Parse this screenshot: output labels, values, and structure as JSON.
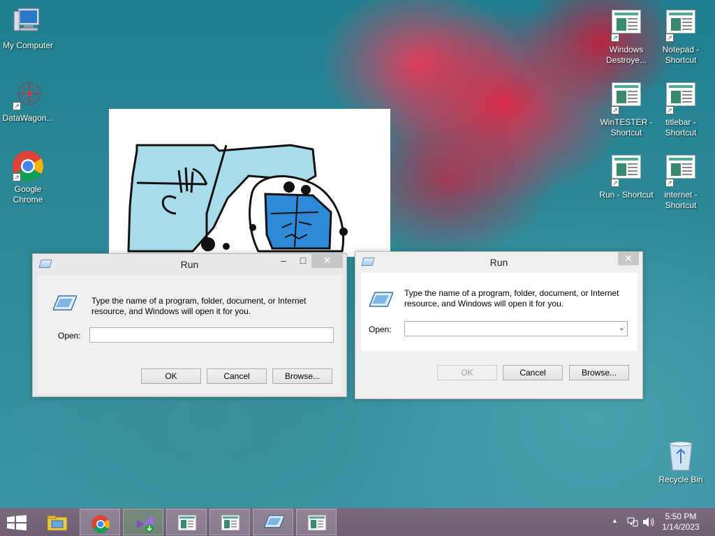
{
  "desktop": {
    "left_icons": [
      {
        "label": "My Computer"
      },
      {
        "label": "DataWagon..."
      },
      {
        "label": "Google Chrome"
      }
    ],
    "right_icons": [
      {
        "label": "Windows Destroye..."
      },
      {
        "label": "Notepad - Shortcut"
      },
      {
        "label": "WinTESTER - Shortcut"
      },
      {
        "label": "titlebar - Shortcut"
      },
      {
        "label": "Run - Shortcut"
      },
      {
        "label": "internet - Shortcut"
      }
    ],
    "recycle_bin": {
      "label": "Recycle Bin"
    }
  },
  "run_left": {
    "title": "Run",
    "prompt": "Type the name of a program, folder, document, or Internet resource, and Windows will open it for you.",
    "open_label": "Open:",
    "input_value": "",
    "ok_label": "OK",
    "cancel_label": "Cancel",
    "browse_label": "Browse..."
  },
  "run_right": {
    "title": "Run",
    "prompt": "Type the name of a program, folder, document, or Internet resource, and Windows will open it for you.",
    "open_label": "Open:",
    "input_value": "",
    "ok_label": "OK",
    "cancel_label": "Cancel",
    "browse_label": "Browse..."
  },
  "taskbar": {
    "items": [
      "file-explorer-icon",
      "chrome-icon",
      "visual-studio-installer-icon",
      "app-window-icon",
      "app-window-icon",
      "run-icon",
      "app-window-icon"
    ],
    "clock_time": "5:50 PM",
    "clock_date": "1/14/2023"
  },
  "colors": {
    "taskbar": "#6e5e73",
    "accent": "#1560c0",
    "window_bg": "#e9e9e9"
  }
}
